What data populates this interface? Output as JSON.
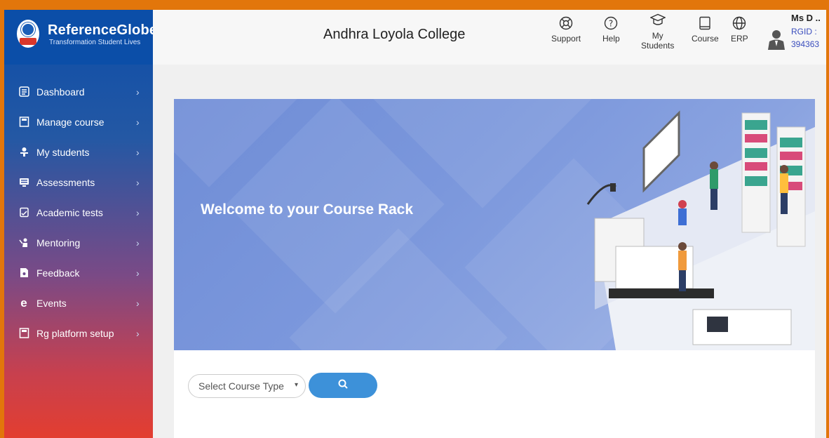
{
  "brand": {
    "name": "ReferenceGlobe",
    "tagline": "Transformation Student Lives"
  },
  "header": {
    "college": "Andhra Loyola College",
    "items": [
      {
        "label": "Support",
        "icon": "support-icon"
      },
      {
        "label": "Help",
        "icon": "help-icon"
      },
      {
        "label_line1": "My",
        "label_line2": "Students",
        "icon": "graduation-cap-icon"
      },
      {
        "label": "Course",
        "icon": "book-icon"
      },
      {
        "label": "ERP",
        "icon": "globe-icon"
      }
    ],
    "profile": {
      "name": "Ms D ..",
      "rgid_label": "RGID :",
      "rgid": "394363"
    }
  },
  "sidebar": {
    "items": [
      {
        "label": "Dashboard",
        "icon": "dashboard-icon"
      },
      {
        "label": "Manage course",
        "icon": "book-icon"
      },
      {
        "label": "My students",
        "icon": "student-icon"
      },
      {
        "label": "Assessments",
        "icon": "monitor-icon"
      },
      {
        "label": "Academic tests",
        "icon": "test-icon"
      },
      {
        "label": "Mentoring",
        "icon": "mentor-icon"
      },
      {
        "label": "Feedback",
        "icon": "feedback-icon"
      },
      {
        "label": "Events",
        "icon": "events-icon"
      },
      {
        "label": "Rg platform setup",
        "icon": "setup-icon"
      }
    ]
  },
  "banner": {
    "title": "Welcome to your Course Rack"
  },
  "search": {
    "select_value": "Select Course Type"
  },
  "colors": {
    "accent": "#3d91d9",
    "sidebar_top": "#0c4da8",
    "sidebar_bottom": "#e33e30",
    "border": "#e2760b"
  }
}
